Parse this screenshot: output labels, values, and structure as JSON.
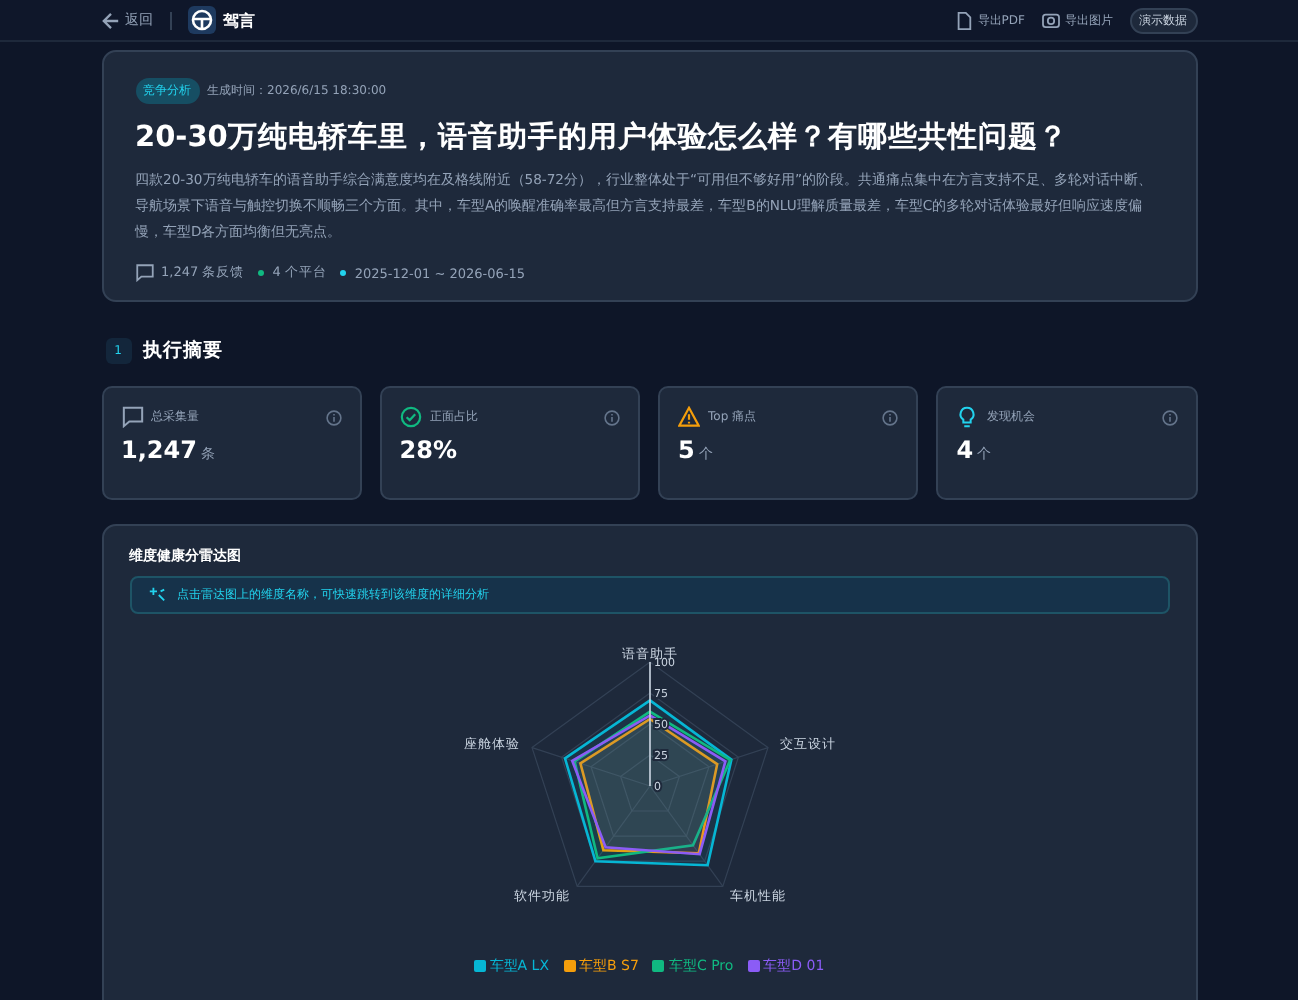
{
  "header": {
    "back": "返回",
    "brand": "驾言",
    "actions": [
      {
        "kind": "pdf",
        "label": "导出PDF"
      },
      {
        "kind": "image",
        "label": "导出图片"
      }
    ],
    "badge": "演示数据"
  },
  "hero": {
    "tag": "竞争分析",
    "generated": "生成时间：2026/6/15 18:30:00",
    "title": "20-30万纯电轿车里，语音助手的用户体验怎么样？有哪些共性问题？",
    "summary": "四款20-30万纯电轿车的语音助手综合满意度均在及格线附近（58-72分），行业整体处于“可用但不够好用”的阶段。共通痛点集中在方言支持不足、多轮对话中断、导航场景下语音与触控切换不顺畅三个方面。其中，车型A的唤醒准确率最高但方言支持最差，车型B的NLU理解质量最差，车型C的多轮对话体验最好但响应速度偏慢，车型D各方面均衡但无亮点。",
    "meta": [
      {
        "kind": "feedback",
        "text": "1,247 条反馈"
      },
      {
        "kind": "dot",
        "color": "#10b981",
        "text": "4 个平台"
      },
      {
        "kind": "dot",
        "color": "#22d3ee",
        "text": "2025-12-01 ~ 2026-06-15"
      }
    ]
  },
  "section": {
    "number": "1",
    "title": "执行摘要"
  },
  "stats": [
    {
      "kind": "chat",
      "label": "总采集量",
      "value": "1,247",
      "unit": "条"
    },
    {
      "kind": "check",
      "label": "正面占比",
      "value": "28%"
    },
    {
      "kind": "warning",
      "label": "Top 痛点",
      "value": "5",
      "unit": "个"
    },
    {
      "kind": "bulb",
      "label": "发现机会",
      "value": "4",
      "unit": "个"
    }
  ],
  "radar": {
    "title": "维度健康分雷达图",
    "hint": "点击雷达图上的维度名称，可快速跳转到该维度的详细分析",
    "chart_data": {
      "type": "radar",
      "categories": [
        "语音助手",
        "交互设计",
        "车机性能",
        "软件功能",
        "座舱体验"
      ],
      "ylim": [
        0,
        100
      ],
      "yticks": [
        0,
        25,
        50,
        75,
        100
      ],
      "series": [
        {
          "name": "车型A LX",
          "color": "#06b6d4",
          "values": [
            69,
            69,
            79,
            75,
            72
          ]
        },
        {
          "name": "车型B S7",
          "color": "#f59e0b",
          "values": [
            54,
            57,
            67,
            64,
            59
          ]
        },
        {
          "name": "车型C Pro",
          "color": "#10b981",
          "values": [
            60,
            68,
            59,
            72,
            64
          ]
        },
        {
          "name": "车型D 01",
          "color": "#8b5cf6",
          "values": [
            57,
            64,
            68,
            61,
            66
          ]
        }
      ]
    }
  }
}
